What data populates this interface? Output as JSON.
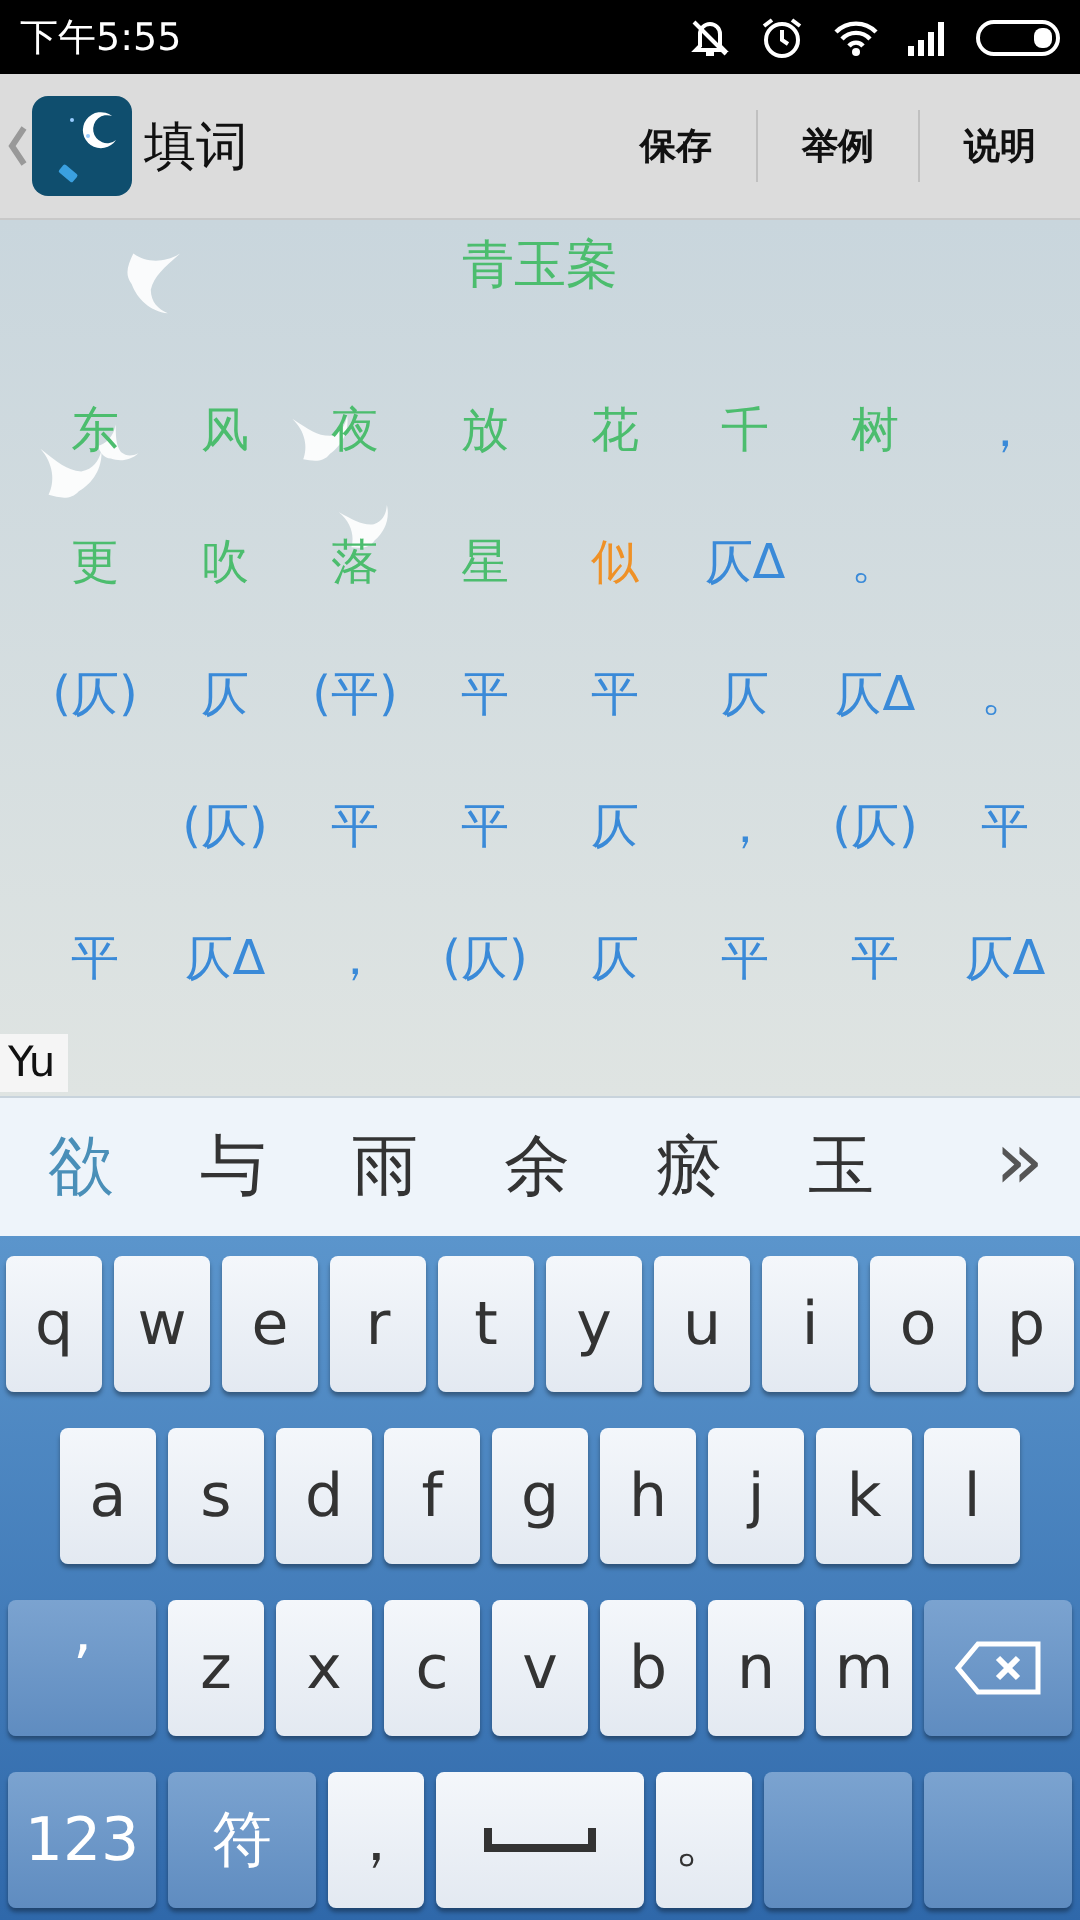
{
  "status_bar": {
    "time": "下午5:55"
  },
  "toolbar": {
    "title": "填词",
    "actions": [
      "保存",
      "举例",
      "说明"
    ]
  },
  "poem": {
    "title": "青玉案",
    "rows": [
      [
        {
          "text": "东",
          "kind": "filled"
        },
        {
          "text": "风",
          "kind": "filled"
        },
        {
          "text": "夜",
          "kind": "filled"
        },
        {
          "text": "放",
          "kind": "filled"
        },
        {
          "text": "花",
          "kind": "filled"
        },
        {
          "text": "千",
          "kind": "filled"
        },
        {
          "text": "树",
          "kind": "filled"
        },
        {
          "text": "，",
          "kind": "pattern"
        }
      ],
      [
        {
          "text": "更",
          "kind": "filled"
        },
        {
          "text": "吹",
          "kind": "filled"
        },
        {
          "text": "落",
          "kind": "filled"
        },
        {
          "text": "星",
          "kind": "filled"
        },
        {
          "text": "似",
          "kind": "current"
        },
        {
          "text": "仄Δ",
          "kind": "pattern"
        },
        {
          "text": "。",
          "kind": "pattern"
        }
      ],
      [
        {
          "text": "(仄)",
          "kind": "pattern"
        },
        {
          "text": "仄",
          "kind": "pattern"
        },
        {
          "text": "(平)",
          "kind": "pattern"
        },
        {
          "text": "平",
          "kind": "pattern"
        },
        {
          "text": "平",
          "kind": "pattern"
        },
        {
          "text": "仄",
          "kind": "pattern"
        },
        {
          "text": "仄Δ",
          "kind": "pattern"
        },
        {
          "text": "。",
          "kind": "pattern"
        }
      ],
      [
        {
          "kind": "gap"
        },
        {
          "text": "(仄)",
          "kind": "pattern"
        },
        {
          "text": "平",
          "kind": "pattern"
        },
        {
          "text": "平",
          "kind": "pattern"
        },
        {
          "text": "仄",
          "kind": "pattern"
        },
        {
          "text": "，",
          "kind": "pattern"
        },
        {
          "text": "(仄)",
          "kind": "pattern"
        },
        {
          "text": "平",
          "kind": "pattern"
        }
      ],
      [
        {
          "text": "平",
          "kind": "pattern"
        },
        {
          "text": "仄Δ",
          "kind": "pattern"
        },
        {
          "text": "，",
          "kind": "pattern"
        },
        {
          "text": "(仄)",
          "kind": "pattern"
        },
        {
          "text": "仄",
          "kind": "pattern"
        },
        {
          "text": "平",
          "kind": "pattern"
        },
        {
          "text": "平",
          "kind": "pattern"
        },
        {
          "text": "仄Δ",
          "kind": "pattern"
        }
      ]
    ]
  },
  "composing": {
    "text": "Yu"
  },
  "candidates": {
    "items": [
      {
        "text": "欲",
        "selected": true
      },
      {
        "text": "与",
        "selected": false
      },
      {
        "text": "雨",
        "selected": false
      },
      {
        "text": "余",
        "selected": false
      },
      {
        "text": "瘀",
        "selected": false
      },
      {
        "text": "玉",
        "selected": false
      }
    ],
    "more": "»"
  },
  "keyboard": {
    "rows": [
      [
        {
          "label": "q",
          "kind": "letter"
        },
        {
          "label": "w",
          "kind": "letter"
        },
        {
          "label": "e",
          "kind": "letter"
        },
        {
          "label": "r",
          "kind": "letter"
        },
        {
          "label": "t",
          "kind": "letter"
        },
        {
          "label": "y",
          "kind": "letter"
        },
        {
          "label": "u",
          "kind": "letter"
        },
        {
          "label": "i",
          "kind": "letter"
        },
        {
          "label": "o",
          "kind": "letter"
        },
        {
          "label": "p",
          "kind": "letter"
        }
      ],
      [
        {
          "label": "a",
          "kind": "letter"
        },
        {
          "label": "s",
          "kind": "letter"
        },
        {
          "label": "d",
          "kind": "letter"
        },
        {
          "label": "f",
          "kind": "letter"
        },
        {
          "label": "g",
          "kind": "letter"
        },
        {
          "label": "h",
          "kind": "letter"
        },
        {
          "label": "j",
          "kind": "letter"
        },
        {
          "label": "k",
          "kind": "letter"
        },
        {
          "label": "l",
          "kind": "letter"
        }
      ],
      [
        {
          "label": "’",
          "kind": "function"
        },
        {
          "label": "z",
          "kind": "letter"
        },
        {
          "label": "x",
          "kind": "letter"
        },
        {
          "label": "c",
          "kind": "letter"
        },
        {
          "label": "v",
          "kind": "letter"
        },
        {
          "label": "b",
          "kind": "letter"
        },
        {
          "label": "n",
          "kind": "letter"
        },
        {
          "label": "m",
          "kind": "letter"
        },
        {
          "kind": "backspace"
        }
      ],
      [
        {
          "label": "123",
          "kind": "function"
        },
        {
          "label": "符",
          "kind": "function"
        },
        {
          "label": "，",
          "kind": "letter"
        },
        {
          "kind": "space"
        },
        {
          "label": "。",
          "kind": "letter"
        },
        {
          "kind": "blank"
        },
        {
          "kind": "blank"
        }
      ]
    ]
  }
}
